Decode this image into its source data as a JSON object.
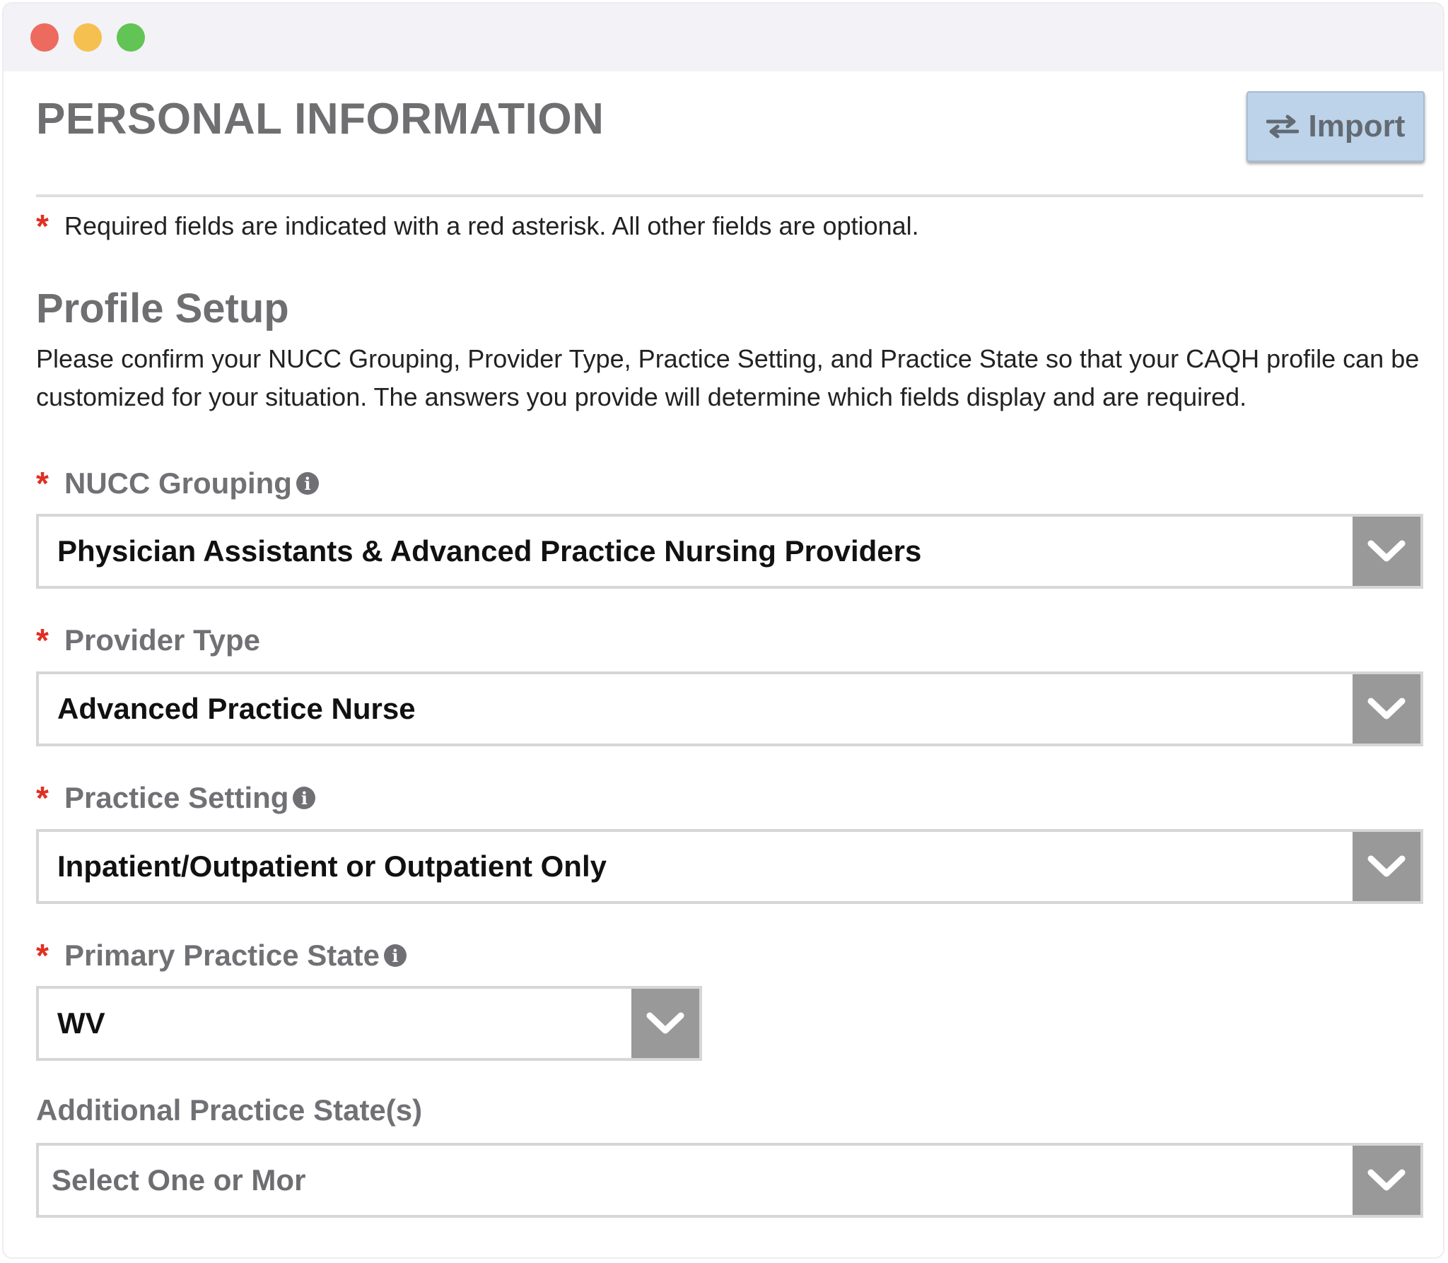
{
  "window": {
    "controls": [
      "close",
      "minimize",
      "zoom"
    ]
  },
  "header": {
    "title": "PERSONAL INFORMATION",
    "import_label": "Import",
    "import_icon": "swap-arrows-icon"
  },
  "required_note": {
    "asterisk": "*",
    "text": "Required fields are indicated with a red asterisk. All other fields are optional."
  },
  "profile_setup": {
    "title": "Profile Setup",
    "description": "Please confirm your NUCC Grouping, Provider Type, Practice Setting, and Practice State so that your CAQH profile can be customized for your situation. The answers you provide will determine which fields display and are required."
  },
  "fields": [
    {
      "label": "NUCC Grouping",
      "required": true,
      "has_info": true,
      "value": "Physician Assistants & Advanced Practice Nursing Providers"
    },
    {
      "label": "Provider Type",
      "required": true,
      "has_info": false,
      "value": "Advanced Practice Nurse"
    },
    {
      "label": "Practice Setting",
      "required": true,
      "has_info": true,
      "value": "Inpatient/Outpatient or Outpatient Only"
    },
    {
      "label": "Primary Practice State",
      "required": true,
      "has_info": true,
      "value": "WV"
    },
    {
      "label": "Additional Practice State(s)",
      "required": false,
      "has_info": false,
      "value": "",
      "placeholder": "Select One or Mor"
    }
  ],
  "colors": {
    "title_gray": "#6f6f72",
    "asterisk_red": "#e02f22",
    "import_bg": "#bcd3ea",
    "dropdown_arrow_bg": "#999999"
  }
}
